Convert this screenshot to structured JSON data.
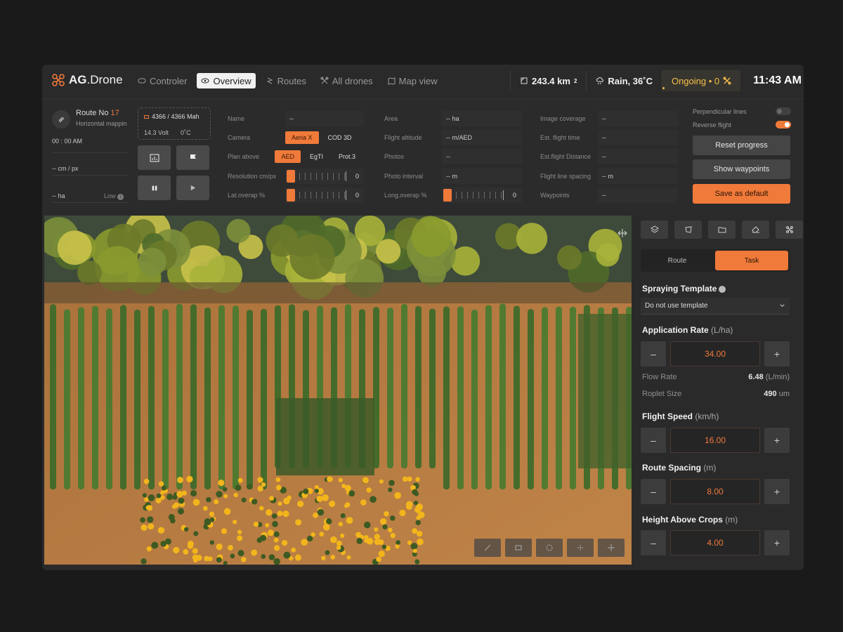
{
  "app": {
    "name_bold": "AG",
    "name_rest": ".Drone"
  },
  "nav": [
    {
      "label": "Controler",
      "active": false
    },
    {
      "label": "Overview",
      "active": true
    },
    {
      "label": "Routes",
      "active": false
    },
    {
      "label": "All drones",
      "active": false
    },
    {
      "label": "Map view",
      "active": false
    }
  ],
  "stats": {
    "area": "243.4 km",
    "area_sup": "2",
    "weather": "Rain, 36˚C",
    "status": "Ongoing • 0",
    "time": "11:43 AM"
  },
  "route": {
    "title": "Route No ",
    "number": "17",
    "subtitle": "Horizontal mapping",
    "time": "00 : 00 AM",
    "resolution": "-- cm / px",
    "area": "-- ha",
    "quality": "Low"
  },
  "battery": {
    "capacity": "4366 / 4366 Mah",
    "voltage": "14.3 Volt",
    "temp": "0˚C"
  },
  "col1": {
    "name_label": "Name",
    "name_value": "--",
    "camera_label": "Camera",
    "camera_options": [
      "Aeria X",
      "COD 3D"
    ],
    "plan_label": "Plan above",
    "plan_options": [
      "AED",
      "EgTI",
      "Prot.3"
    ],
    "resolution_label": "Resolution cm/px",
    "resolution_value": "0",
    "latoverlap_label": "Lat.overap %",
    "latoverlap_value": "0"
  },
  "col2": {
    "area_label": "Area",
    "area_value": "-- ha",
    "altitude_label": "Flight altitude",
    "altitude_value": "-- m/AED",
    "photos_label": "Photos",
    "photos_value": "--",
    "interval_label": "Photo interval",
    "interval_value": "-- m",
    "longoverlap_label": "Long.overap %",
    "longoverlap_value": "0"
  },
  "col3": {
    "coverage_label": "Image coverage",
    "coverage_value": "--",
    "time_label": "Est. flight time",
    "time_value": "--",
    "distance_label": "Est.flight Distance",
    "distance_value": "--",
    "spacing_label": "Flight line spacing",
    "spacing_value": "-- m",
    "waypoints_label": "Waypoints",
    "waypoints_value": "--"
  },
  "toggles": {
    "perpendicular": "Perpendicular lines",
    "reverse": "Reverse flight"
  },
  "buttons": {
    "reset": "Reset progress",
    "show": "Show waypoints",
    "save": "Save as default"
  },
  "panel": {
    "tabs": [
      "Route",
      "Task"
    ],
    "template_title": "Spraying Template",
    "template_value": "Do not use template",
    "rate_title": "Application Rate",
    "rate_unit": "(L/ha)",
    "rate_value": "34.00",
    "flow_label": "Flow Rate",
    "flow_value": "6.48",
    "flow_unit": " (L/min)",
    "droplet_label": "Roplet Size",
    "droplet_value": "490",
    "droplet_unit": " um",
    "speed_title": "Flight Speed",
    "speed_unit": "(km/h)",
    "speed_value": "16.00",
    "spacing_title": "Route Spacing",
    "spacing_unit": "(m)",
    "spacing_value": "8.00",
    "height_title": "Height Above Crops",
    "height_unit": "(m)",
    "height_value": "4.00",
    "minus": "–",
    "plus": "+"
  },
  "colors": {
    "accent": "#f07a3a",
    "bg": "#2a2a2b",
    "status": "#f5c24a"
  }
}
